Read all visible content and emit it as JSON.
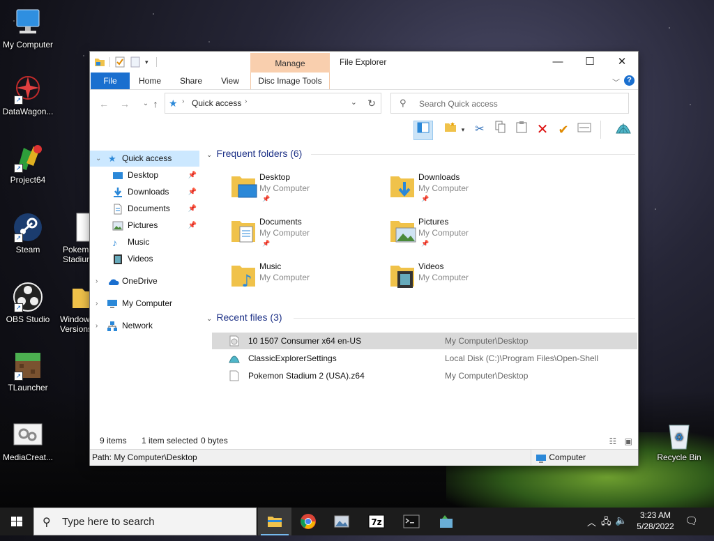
{
  "desktop": {
    "icons": [
      {
        "label": "My Computer"
      },
      {
        "label": "DataWagon..."
      },
      {
        "label": "Project64"
      },
      {
        "label": "Steam"
      },
      {
        "label": "Pokem Stadium"
      },
      {
        "label": "OBS Studio"
      },
      {
        "label": "Window Versions"
      },
      {
        "label": "TLauncher"
      },
      {
        "label": "MediaCreat..."
      },
      {
        "label": "Recycle Bin"
      }
    ]
  },
  "window": {
    "title": "File Explorer",
    "manage_tab": "Manage",
    "controls": {
      "minimize": "—",
      "maximize": "☐",
      "close": "✕"
    },
    "ribbon_tabs": [
      {
        "label": "File"
      },
      {
        "label": "Home"
      },
      {
        "label": "Share"
      },
      {
        "label": "View"
      },
      {
        "label": "Disc Image Tools"
      }
    ],
    "help_label": "?",
    "address": {
      "crumb": "Quick access"
    },
    "search": {
      "placeholder": "Search Quick access"
    }
  },
  "nav": {
    "items": [
      {
        "label": "Quick access",
        "selected": true
      },
      {
        "label": "Desktop"
      },
      {
        "label": "Downloads"
      },
      {
        "label": "Documents"
      },
      {
        "label": "Pictures"
      },
      {
        "label": "Music"
      },
      {
        "label": "Videos"
      },
      {
        "label": "OneDrive"
      },
      {
        "label": "My Computer"
      },
      {
        "label": "Network"
      }
    ]
  },
  "content": {
    "frequent_header": "Frequent folders (6)",
    "frequent": [
      {
        "name": "Desktop",
        "location": "My Computer"
      },
      {
        "name": "Downloads",
        "location": "My Computer"
      },
      {
        "name": "Documents",
        "location": "My Computer"
      },
      {
        "name": "Pictures",
        "location": "My Computer"
      },
      {
        "name": "Music",
        "location": "My Computer"
      },
      {
        "name": "Videos",
        "location": "My Computer"
      }
    ],
    "recent_header": "Recent files (3)",
    "recent": [
      {
        "name": "10 1507 Consumer x64 en-US",
        "path": "My Computer\\Desktop",
        "selected": true
      },
      {
        "name": "ClassicExplorerSettings",
        "path": "Local Disk (C:)\\Program Files\\Open-Shell"
      },
      {
        "name": "Pokemon Stadium 2 (USA).z64",
        "path": "My Computer\\Desktop"
      }
    ]
  },
  "status": {
    "items": "9 items",
    "selected": "1 item selected",
    "size": "0 bytes"
  },
  "pathbar": {
    "path": "Path: My Computer\\Desktop",
    "location": "Computer"
  },
  "taskbar": {
    "search_placeholder": "Type here to search",
    "time": "3:23 AM",
    "date": "5/28/2022"
  },
  "colors": {
    "accent": "#1a6fcf",
    "manage_tab": "#f9cfae",
    "selection": "#cce8ff",
    "header_text": "#1e3287"
  }
}
